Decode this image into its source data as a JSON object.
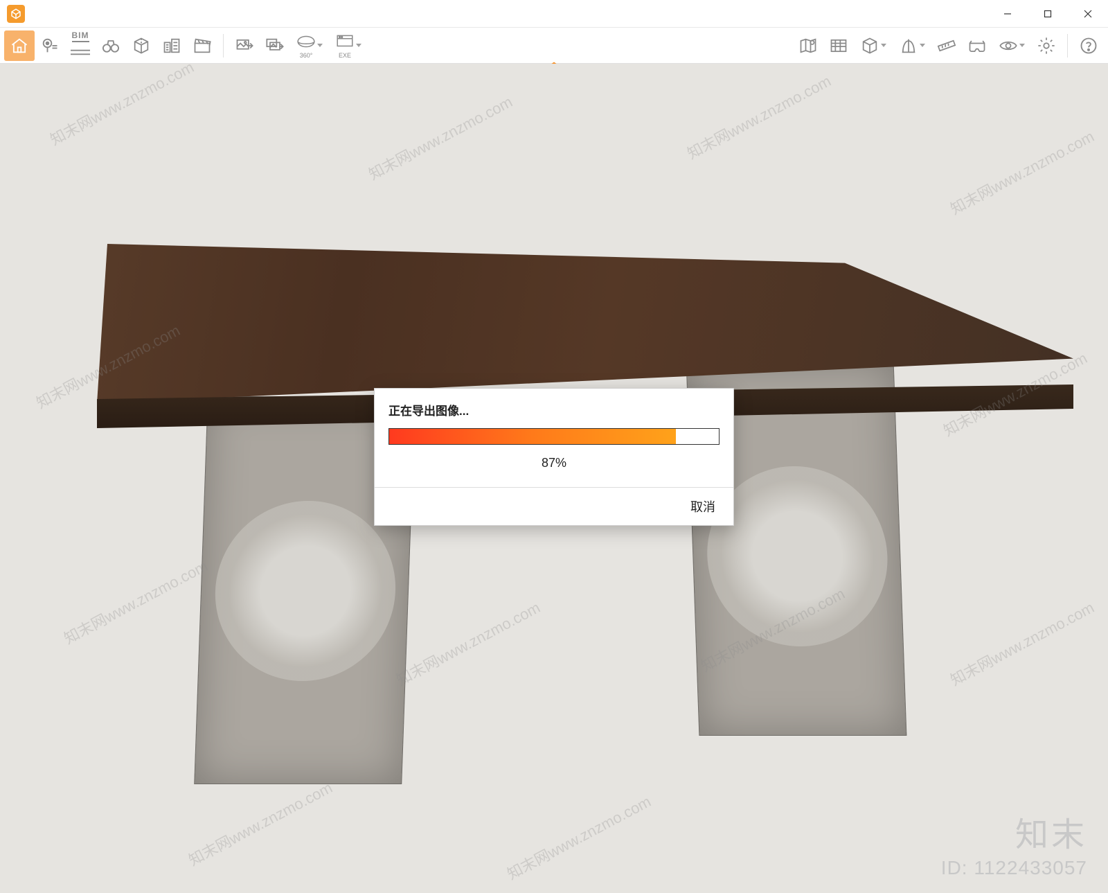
{
  "window": {
    "title": ""
  },
  "toolbar_left": {
    "home": "home",
    "pin": "pin",
    "bim": "BIM",
    "binoculars": "binoculars",
    "nav_cube": "nav-cube",
    "buildings": "buildings",
    "clapper": "clapperboard",
    "export_img": "export-image",
    "export_img_batch": "export-image-batch",
    "pano_360_label": "360°",
    "exe_label": "EXE"
  },
  "toolbar_right": {
    "map": "map",
    "sheet": "sheet",
    "cube": "cube",
    "section": "section",
    "measure": "measure",
    "vr": "vr-headset",
    "visibility": "visibility",
    "settings": "settings",
    "help": "help"
  },
  "dialog": {
    "title": "正在导出图像...",
    "percent_value": 87,
    "percent_label": "87%",
    "cancel": "取消"
  },
  "watermark": {
    "text": "知末网www.znzmo.com",
    "brand": "知末",
    "id_label": "ID: 1122433057"
  }
}
